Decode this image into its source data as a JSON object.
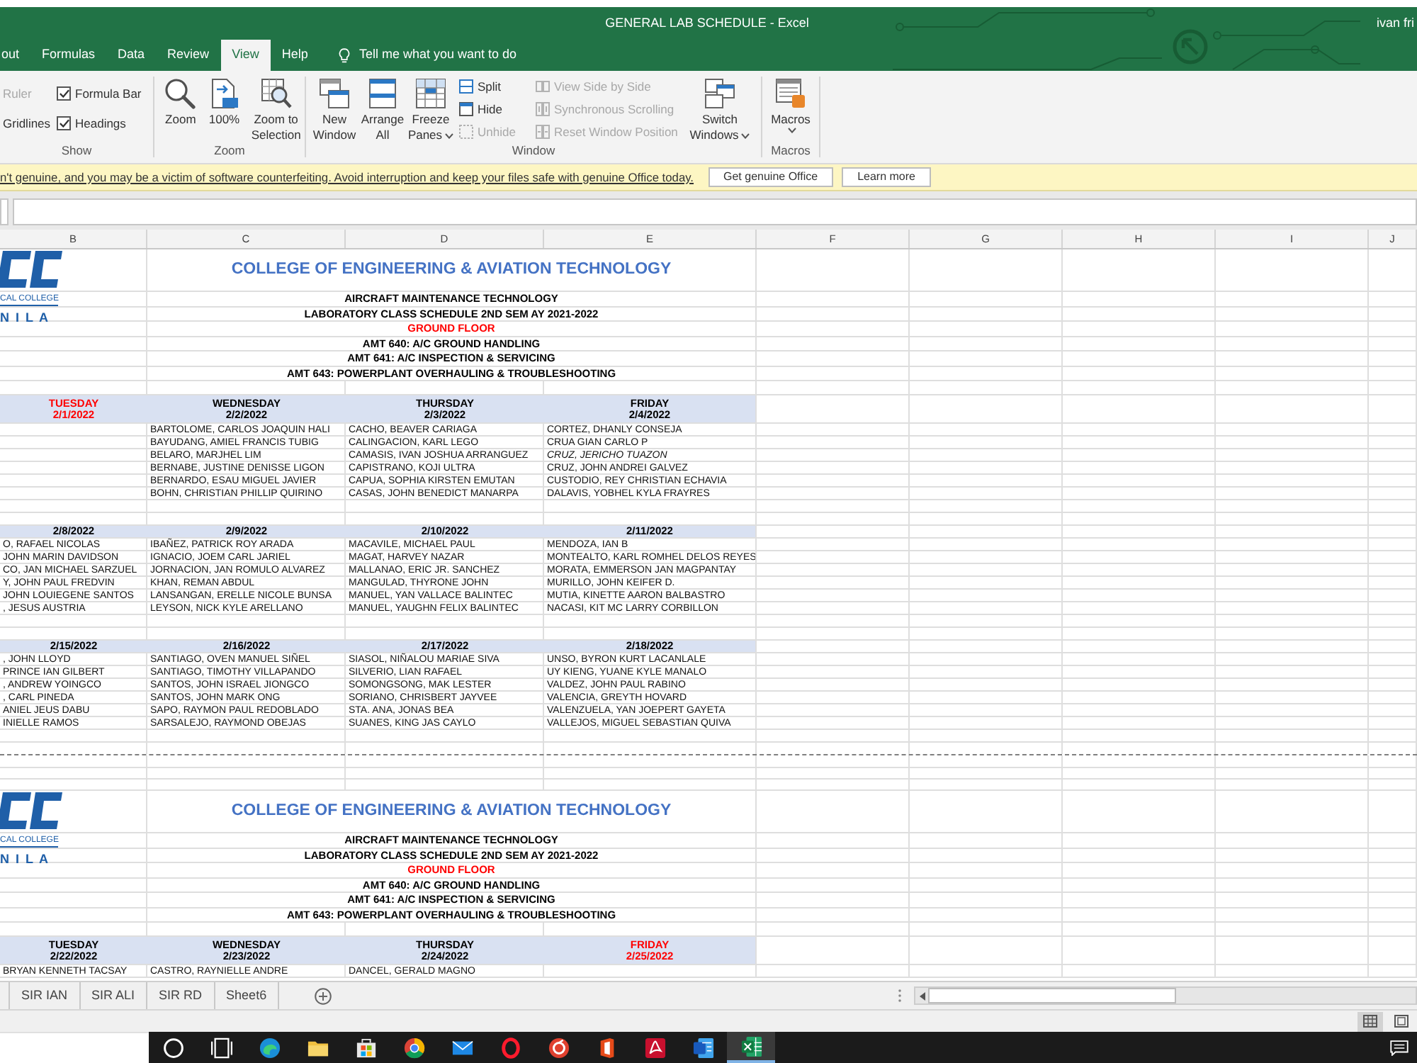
{
  "window": {
    "title": "GENERAL LAB SCHEDULE - Excel",
    "user": "ivan fri"
  },
  "tabs": [
    {
      "label": "out",
      "selected": false
    },
    {
      "label": "Formulas",
      "selected": false
    },
    {
      "label": "Data",
      "selected": false
    },
    {
      "label": "Review",
      "selected": false
    },
    {
      "label": "View",
      "selected": true
    },
    {
      "label": "Help",
      "selected": false
    }
  ],
  "tell_me": {
    "placeholder": "Tell me what you want to do"
  },
  "ribbon": {
    "show": {
      "label": "Show",
      "items": [
        {
          "kind": "plain",
          "label": "Ruler",
          "disabled": true
        },
        {
          "kind": "checkbox",
          "label": "Formula Bar",
          "checked": true,
          "disabled": false
        },
        {
          "kind": "plain",
          "label": "Gridlines",
          "disabled": false
        },
        {
          "kind": "checkbox",
          "label": "Headings",
          "checked": true,
          "disabled": false
        }
      ]
    },
    "zoom": {
      "label": "Zoom",
      "buttons": [
        {
          "kind": "zoom",
          "label": "Zoom"
        },
        {
          "kind": "hundred",
          "label": "100%"
        },
        {
          "kind": "selection",
          "label": "Zoom to Selection"
        }
      ]
    },
    "window": {
      "label": "Window",
      "large": [
        {
          "kind": "new",
          "label": "New Window",
          "dropdown": false
        },
        {
          "kind": "arrange",
          "label": "Arrange All",
          "dropdown": false
        },
        {
          "kind": "freeze",
          "label": "Freeze Panes",
          "dropdown": true
        }
      ],
      "small": [
        {
          "kind": "split",
          "label": "Split",
          "disabled": false
        },
        {
          "kind": "hide",
          "label": "Hide",
          "disabled": false
        },
        {
          "kind": "unhide",
          "label": "Unhide",
          "disabled": true
        }
      ],
      "side": [
        {
          "kind": "side",
          "label": "View Side by Side",
          "disabled": true
        },
        {
          "kind": "sync",
          "label": "Synchronous Scrolling",
          "disabled": true
        },
        {
          "kind": "reset",
          "label": "Reset Window Position",
          "disabled": true
        }
      ],
      "switch": {
        "label": "Switch Windows",
        "dropdown": true
      }
    },
    "macros": {
      "label": "Macros",
      "button": {
        "label": "Macros",
        "dropdown": true
      }
    }
  },
  "notice": {
    "message": "n't genuine, and you may be a victim of software counterfeiting. Avoid interruption and keep your files safe with genuine Office today.",
    "buttons": [
      "Get genuine Office",
      "Learn more"
    ]
  },
  "columns": [
    "B",
    "C",
    "D",
    "E",
    "F",
    "G",
    "H",
    "I",
    "J"
  ],
  "schedule": [
    {
      "kind": "heading",
      "logo": {
        "line_1": "CAL COLLEGE",
        "line_2": "N I L A"
      },
      "title": "COLLEGE OF ENGINEERING & AVIATION TECHNOLOGY",
      "lines": [
        {
          "text": "AIRCRAFT MAINTENANCE TECHNOLOGY",
          "color": "#000000"
        },
        {
          "text": "LABORATORY CLASS SCHEDULE 2ND SEM AY 2021-2022",
          "color": "#000000"
        },
        {
          "text": "GROUND FLOOR",
          "color": "#ff0000"
        },
        {
          "text": "AMT 640: A/C GROUND HANDLING",
          "color": "#000000"
        },
        {
          "text": "AMT 641: A/C INSPECTION & SERVICING",
          "color": "#000000"
        },
        {
          "text": "AMT 643: POWERPLANT OVERHAULING & TROUBLESHOOTING",
          "color": "#000000"
        }
      ]
    },
    {
      "kind": "week",
      "days": [
        {
          "day": "TUESDAY",
          "date": "2/1/2022",
          "color": "#ff0000"
        },
        {
          "day": "WEDNESDAY",
          "date": "2/2/2022",
          "color": "#000000",
          "names": [
            {
              "text": "BARTOLOME, CARLOS JOAQUIN HALI",
              "italic": false
            },
            {
              "text": "BAYUDANG, AMIEL FRANCIS TUBIG",
              "italic": false
            },
            {
              "text": "BELARO, MARJHEL LIM",
              "italic": false
            },
            {
              "text": "BERNABE, JUSTINE DENISSE LIGON",
              "italic": false
            },
            {
              "text": "BERNARDO, ESAU MIGUEL JAVIER",
              "italic": false
            },
            {
              "text": "BOHN, CHRISTIAN PHILLIP QUIRINO",
              "italic": false
            }
          ]
        },
        {
          "day": "THURSDAY",
          "date": "2/3/2022",
          "color": "#000000",
          "names": [
            {
              "text": "CACHO, BEAVER CARIAGA",
              "italic": false
            },
            {
              "text": "CALINGACION, KARL LEGO",
              "italic": false
            },
            {
              "text": "CAMASIS, IVAN JOSHUA ARRANGUEZ",
              "italic": false
            },
            {
              "text": "CAPISTRANO, KOJI ULTRA",
              "italic": false
            },
            {
              "text": "CAPUA, SOPHIA KIRSTEN EMUTAN",
              "italic": false
            },
            {
              "text": "CASAS, JOHN BENEDICT MANARPA",
              "italic": false
            }
          ]
        },
        {
          "day": "FRIDAY",
          "date": "2/4/2022",
          "color": "#000000",
          "names": [
            {
              "text": "CORTEZ, DHANLY CONSEJA",
              "italic": false
            },
            {
              "text": "CRUA GIAN CARLO P",
              "italic": false
            },
            {
              "text": "CRUZ, JERICHO TUAZON",
              "italic": true
            },
            {
              "text": "CRUZ, JOHN ANDREI GALVEZ",
              "italic": false
            },
            {
              "text": "CUSTODIO, REY CHRISTIAN ECHAVIA",
              "italic": false
            },
            {
              "text": "DALAVIS, YOBHEL KYLA FRAYRES",
              "italic": false
            }
          ]
        }
      ]
    },
    {
      "kind": "week",
      "days": [
        {
          "date": "2/8/2022",
          "color": "#000000",
          "names": [
            {
              "text": "O, RAFAEL NICOLAS",
              "italic": false
            },
            {
              "text": "JOHN MARIN DAVIDSON",
              "italic": false
            },
            {
              "text": "CO, JAN MICHAEL SARZUEL",
              "italic": false
            },
            {
              "text": "Y, JOHN PAUL FREDVIN",
              "italic": false
            },
            {
              "text": "JOHN LOUIEGENE SANTOS",
              "italic": false
            },
            {
              "text": ", JESUS AUSTRIA",
              "italic": false
            }
          ]
        },
        {
          "date": "2/9/2022",
          "color": "#000000",
          "names": [
            {
              "text": "IBAÑEZ, PATRICK ROY ARADA",
              "italic": false
            },
            {
              "text": "IGNACIO, JOEM CARL JARIEL",
              "italic": false
            },
            {
              "text": "JORNACION, JAN ROMULO ALVAREZ",
              "italic": false
            },
            {
              "text": "KHAN, REMAN ABDUL",
              "italic": false
            },
            {
              "text": "LANSANGAN, ERELLE NICOLE BUNSA",
              "italic": false
            },
            {
              "text": "LEYSON, NICK KYLE ARELLANO",
              "italic": false
            }
          ]
        },
        {
          "date": "2/10/2022",
          "color": "#000000",
          "names": [
            {
              "text": "MACAVILE, MICHAEL PAUL",
              "italic": false
            },
            {
              "text": "MAGAT, HARVEY NAZAR",
              "italic": false
            },
            {
              "text": "MALLANAO, ERIC JR. SANCHEZ",
              "italic": false
            },
            {
              "text": "MANGULAD, THYRONE JOHN",
              "italic": false
            },
            {
              "text": "MANUEL, YAN VALLACE BALINTEC",
              "italic": false
            },
            {
              "text": "MANUEL, YAUGHN FELIX BALINTEC",
              "italic": false
            }
          ]
        },
        {
          "date": "2/11/2022",
          "color": "#000000",
          "names": [
            {
              "text": "MENDOZA, IAN B",
              "italic": false
            },
            {
              "text": "MONTEALTO, KARL ROMHEL DELOS REYES",
              "italic": false
            },
            {
              "text": "MORATA, EMMERSON JAN MAGPANTAY",
              "italic": false
            },
            {
              "text": "MURILLO, JOHN KEIFER D.",
              "italic": false
            },
            {
              "text": "MUTIA, KINETTE AARON BALBASTRO",
              "italic": false
            },
            {
              "text": "NACASI, KIT MC LARRY CORBILLON",
              "italic": false
            }
          ]
        }
      ]
    },
    {
      "kind": "week",
      "days": [
        {
          "date": "2/15/2022",
          "color": "#000000",
          "names": [
            {
              "text": ", JOHN LLOYD",
              "italic": false
            },
            {
              "text": "PRINCE IAN GILBERT",
              "italic": false
            },
            {
              "text": ", ANDREW YOINGCO",
              "italic": false
            },
            {
              "text": ", CARL PINEDA",
              "italic": false
            },
            {
              "text": "ANIEL JEUS DABU",
              "italic": false
            },
            {
              "text": "INIELLE RAMOS",
              "italic": false
            }
          ]
        },
        {
          "date": "2/16/2022",
          "color": "#000000",
          "names": [
            {
              "text": "SANTIAGO, OVEN MANUEL SIÑEL",
              "italic": false
            },
            {
              "text": "SANTIAGO, TIMOTHY VILLAPANDO",
              "italic": false
            },
            {
              "text": "SANTOS, JOHN ISRAEL JIONGCO",
              "italic": false
            },
            {
              "text": "SANTOS, JOHN MARK ONG",
              "italic": false
            },
            {
              "text": "SAPO, RAYMON PAUL REDOBLADO",
              "italic": false
            },
            {
              "text": "SARSALEJO, RAYMOND OBEJAS",
              "italic": false
            }
          ]
        },
        {
          "date": "2/17/2022",
          "color": "#000000",
          "names": [
            {
              "text": "SIASOL, NIÑALOU MARIAE SIVA",
              "italic": false
            },
            {
              "text": "SILVERIO, LIAN RAFAEL",
              "italic": false
            },
            {
              "text": "SOMONGSONG, MAK LESTER",
              "italic": false
            },
            {
              "text": "SORIANO, CHRISBERT JAYVEE",
              "italic": false
            },
            {
              "text": "STA. ANA, JONAS BEA",
              "italic": false
            },
            {
              "text": "SUANES, KING JAS CAYLO",
              "italic": false
            }
          ]
        },
        {
          "date": "2/18/2022",
          "color": "#000000",
          "names": [
            {
              "text": "UNSO, BYRON KURT LACANLALE",
              "italic": false
            },
            {
              "text": "UY KIENG, YUANE KYLE MANALO",
              "italic": false
            },
            {
              "text": "VALDEZ, JOHN PAUL RABINO",
              "italic": false
            },
            {
              "text": "VALENCIA, GREYTH HOVARD",
              "italic": false
            },
            {
              "text": "VALENZUELA, YAN JOEPERT GAYETA",
              "italic": false
            },
            {
              "text": "VALLEJOS, MIGUEL SEBASTIAN QUIVA",
              "italic": false
            }
          ]
        }
      ]
    },
    {
      "kind": "heading",
      "logo": {
        "line_1": "CAL COLLEGE",
        "line_2": "N I L A"
      },
      "title": "COLLEGE OF ENGINEERING & AVIATION TECHNOLOGY",
      "lines": [
        {
          "text": "AIRCRAFT MAINTENANCE TECHNOLOGY",
          "color": "#000000"
        },
        {
          "text": "LABORATORY CLASS SCHEDULE 2ND SEM AY 2021-2022",
          "color": "#000000"
        },
        {
          "text": "GROUND FLOOR",
          "color": "#ff0000"
        },
        {
          "text": "AMT 640: A/C GROUND HANDLING",
          "color": "#000000"
        },
        {
          "text": "AMT 641: A/C INSPECTION & SERVICING",
          "color": "#000000"
        },
        {
          "text": "AMT 643: POWERPLANT OVERHAULING & TROUBLESHOOTING",
          "color": "#000000"
        }
      ]
    },
    {
      "kind": "week",
      "days": [
        {
          "day": "TUESDAY",
          "date": "2/22/2022",
          "color": "#000000",
          "names": [
            {
              "text": "BRYAN KENNETH TACSAY",
              "italic": false
            }
          ]
        },
        {
          "day": "WEDNESDAY",
          "date": "2/23/2022",
          "color": "#000000",
          "names": [
            {
              "text": "CASTRO, RAYNIELLE ANDRE",
              "italic": false
            }
          ]
        },
        {
          "day": "THURSDAY",
          "date": "2/24/2022",
          "color": "#000000",
          "names": [
            {
              "text": "DANCEL, GERALD MAGNO",
              "italic": false
            }
          ]
        },
        {
          "day": "FRIDAY",
          "date": "2/25/2022",
          "color": "#ff0000"
        }
      ]
    }
  ],
  "sheets": [
    {
      "label": "SIR IAN",
      "selected": false
    },
    {
      "label": "SIR ALI",
      "selected": false
    },
    {
      "label": "SIR RD",
      "selected": false
    },
    {
      "label": "Sheet6",
      "selected": false
    }
  ],
  "status_views": [
    {
      "kind": "normal",
      "selected": true
    },
    {
      "kind": "page_layout",
      "selected": false
    }
  ],
  "taskbar": [
    {
      "kind": "circle",
      "selected": false
    },
    {
      "kind": "task_view",
      "selected": false
    },
    {
      "kind": "swirl_browser",
      "selected": false
    },
    {
      "kind": "folder",
      "selected": false
    },
    {
      "kind": "bag",
      "selected": false
    },
    {
      "kind": "ring_browser",
      "selected": false
    },
    {
      "kind": "envelope",
      "selected": false
    },
    {
      "kind": "red_ring",
      "selected": false
    },
    {
      "kind": "round_app",
      "selected": false
    },
    {
      "kind": "door_tile",
      "selected": false
    },
    {
      "kind": "pdf_tile",
      "selected": false
    },
    {
      "kind": "document_tile",
      "selected": false
    },
    {
      "kind": "spreadsheet_tile",
      "selected": true
    }
  ]
}
